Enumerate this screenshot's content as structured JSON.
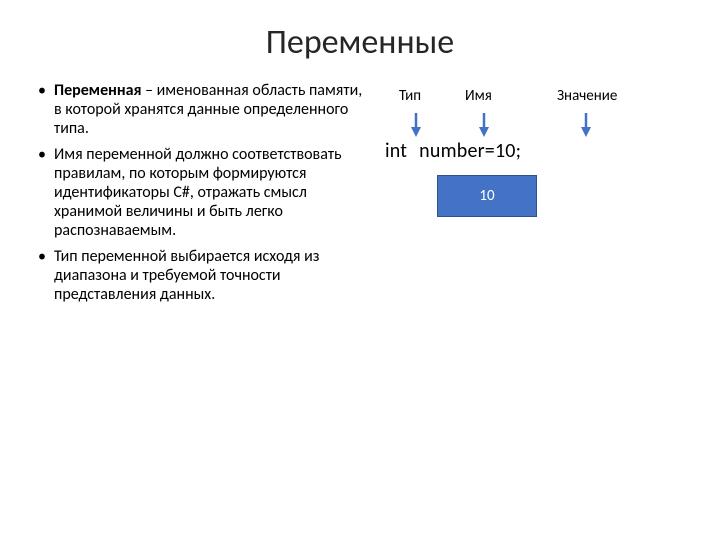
{
  "title": "Переменные",
  "bullets": {
    "b1_bold": "Переменная",
    "b1_rest": " – именованная область памяти, в которой хранятся данные определенного типа.",
    "b2": "Имя переменной должно соответствовать правилам, по которым формируются идентификаторы C#, отражать смысл хранимой величины и быть легко распознаваемым.",
    "b3": "Тип переменной выбирается исходя из диапазона и требуемой точности представления данных."
  },
  "diagram": {
    "label_type": "Тип",
    "label_name": "Имя",
    "label_value": "Значение",
    "code_type": "int",
    "code_name": "number",
    "code_eq": "=",
    "code_value": "10",
    "code_semi": ";",
    "box_value": "10"
  },
  "colors": {
    "arrow": "#4472c4",
    "box_fill": "#4472c4",
    "box_border": "#2f528f"
  }
}
